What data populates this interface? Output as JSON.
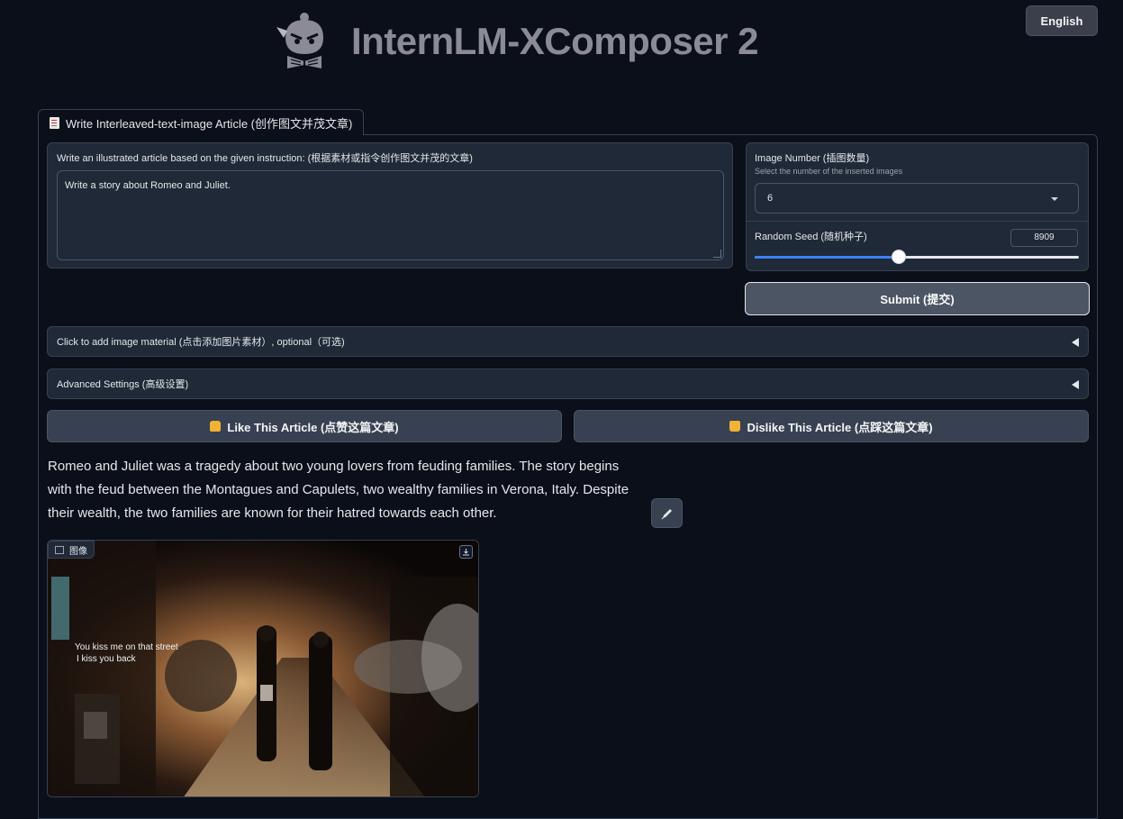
{
  "header": {
    "app_title": "InternLM-XComposer 2",
    "language_button": "English"
  },
  "tab": {
    "label": "Write Interleaved-text-image Article (创作图文并茂文章)"
  },
  "instruction": {
    "label": "Write an illustrated article based on the given instruction: (根据素材或指令创作图文并茂的文章)",
    "value": "Write a story about Romeo and Juliet."
  },
  "image_number": {
    "label": "Image Number (插图数量)",
    "description": "Select the number of the inserted images",
    "selected": "6"
  },
  "random_seed": {
    "label": "Random Seed (随机种子)",
    "value": "8909",
    "slider_fraction": 0.445
  },
  "submit_label": "Submit (提交)",
  "accordions": {
    "image_material": "Click to add image material (点击添加图片素材）, optional（可选)",
    "advanced": "Advanced Settings (高级设置)"
  },
  "feedback": {
    "like_label": "Like This Article (点赞这篇文章)",
    "dislike_label": "Dislike This Article (点踩这篇文章)"
  },
  "article": {
    "paragraph_1": "Romeo and Juliet was a tragedy about two young lovers from feuding families. The story begins with the feud between the Montagues and Capulets, two wealthy families in Verona, Italy. Despite their wealth, the two families are known for their hatred towards each other."
  },
  "image_output": {
    "label": "图像",
    "caption_line_1": "You kiss me on that street",
    "caption_line_2": "I kiss you back"
  },
  "icons": {
    "logo": "mascot-reading-book-icon",
    "like": "thumbs-up-icon",
    "dislike": "thumbs-down-icon",
    "edit": "pencil-icon",
    "download": "download-icon",
    "image_label": "image-icon",
    "accordion_toggle": "triangle-left-icon",
    "dropdown": "chevron-down-icon"
  },
  "colors": {
    "background": "#0b0f19",
    "panel": "#1f2937",
    "border": "#374151",
    "accent": "#3b82f6",
    "title_gray": "#8b8b95"
  }
}
